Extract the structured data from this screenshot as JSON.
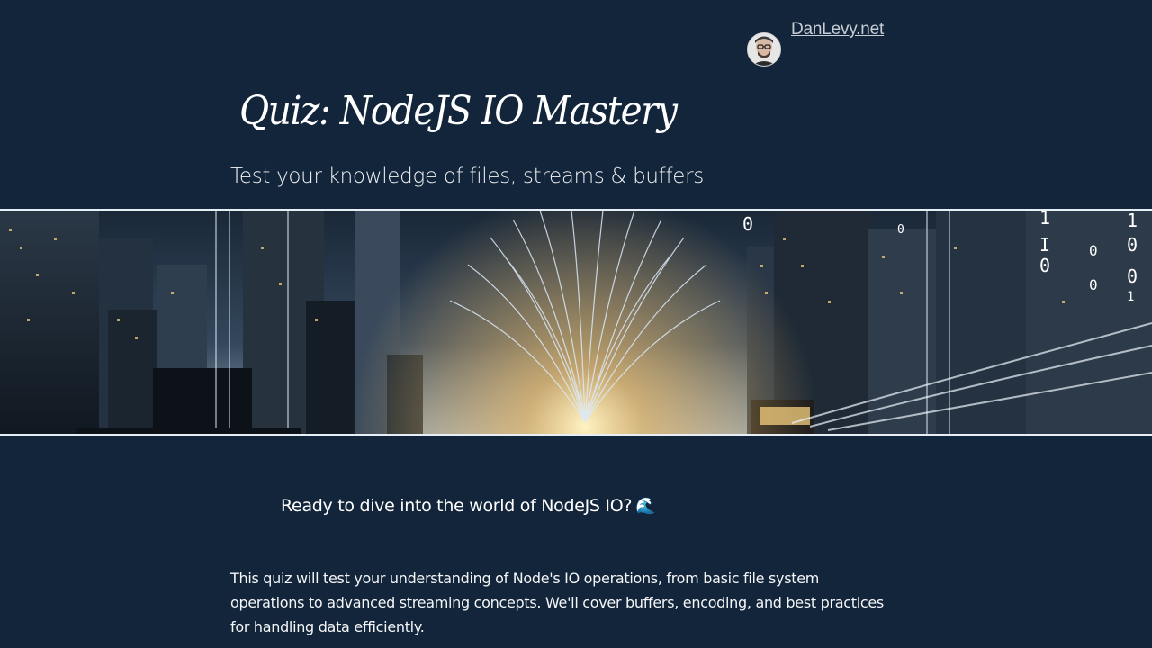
{
  "header": {
    "site_link": "DanLevy.net",
    "avatar_icon": "author-avatar"
  },
  "main": {
    "title": "Quiz: NodeJS IO Mastery",
    "subtitle": "Test your knowledge of files, streams & buffers",
    "hero_image": "city-fiber-optic-banner",
    "lead_text": "Ready to dive into the world of NodeJS IO?",
    "lead_emoji": "🌊",
    "intro_text": "This quiz will test your understanding of Node's IO operations, from basic file system operations to advanced streaming concepts. We'll cover buffers, encoding, and best practices for handling data efficiently."
  },
  "colors": {
    "background": "#12253a",
    "link": "#c9ced6",
    "text": "#ffffff"
  }
}
